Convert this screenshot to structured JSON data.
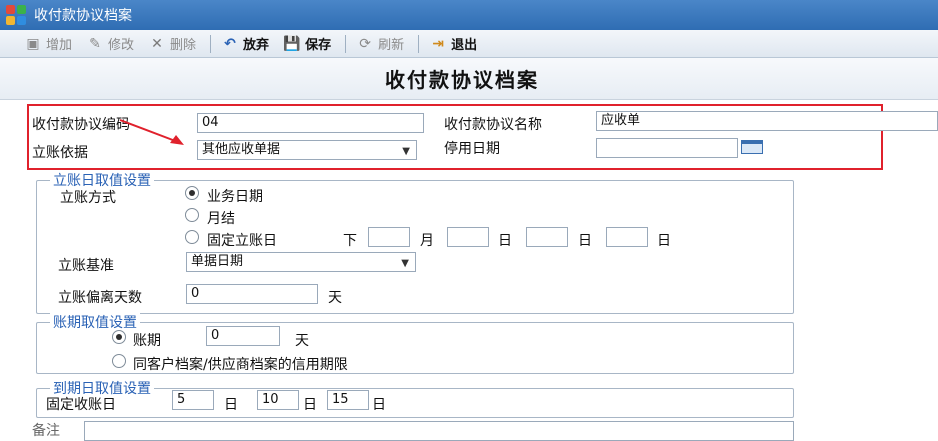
{
  "window": {
    "title": "收付款协议档案"
  },
  "toolbar": {
    "add": "增加",
    "edit": "修改",
    "delete": "删除",
    "discard": "放弃",
    "save": "保存",
    "refresh": "刷新",
    "exit": "退出"
  },
  "page": {
    "title": "收付款协议档案"
  },
  "form": {
    "code_label": "收付款协议编码",
    "code_value": "04",
    "name_label": "收付款协议名称",
    "name_value": "应收单",
    "basis_label": "立账依据",
    "basis_value": "其他应收单据",
    "stop_date_label": "停用日期",
    "stop_date_value": ""
  },
  "account_date_group": {
    "legend": "立账日取值设置",
    "method_label": "立账方式",
    "opt_business_date": "业务日期",
    "opt_month_end": "月结",
    "opt_fixed_day": "固定立账日",
    "fixed_prefix": "下",
    "unit_month": "月",
    "unit_day1": "日",
    "unit_day2": "日",
    "unit_day3": "日",
    "basis_label": "立账基准",
    "basis_value": "单据日期",
    "offset_label": "立账偏离天数",
    "offset_value": "0",
    "offset_unit": "天"
  },
  "period_group": {
    "legend": "账期取值设置",
    "opt_period": "账期",
    "period_value": "0",
    "period_unit": "天",
    "opt_credit": "同客户档案/供应商档案的信用期限"
  },
  "due_group": {
    "legend": "到期日取值设置",
    "fixed_label": "固定收账日",
    "day1": "5",
    "unit1": "日",
    "day2": "10",
    "unit2": "日",
    "day3": "15",
    "unit3": "日"
  },
  "remarks": {
    "label": "备注"
  },
  "colors": {
    "title_bar": "#2f6db3",
    "highlight": "#e0212c",
    "legend_text": "#2a62b5"
  }
}
